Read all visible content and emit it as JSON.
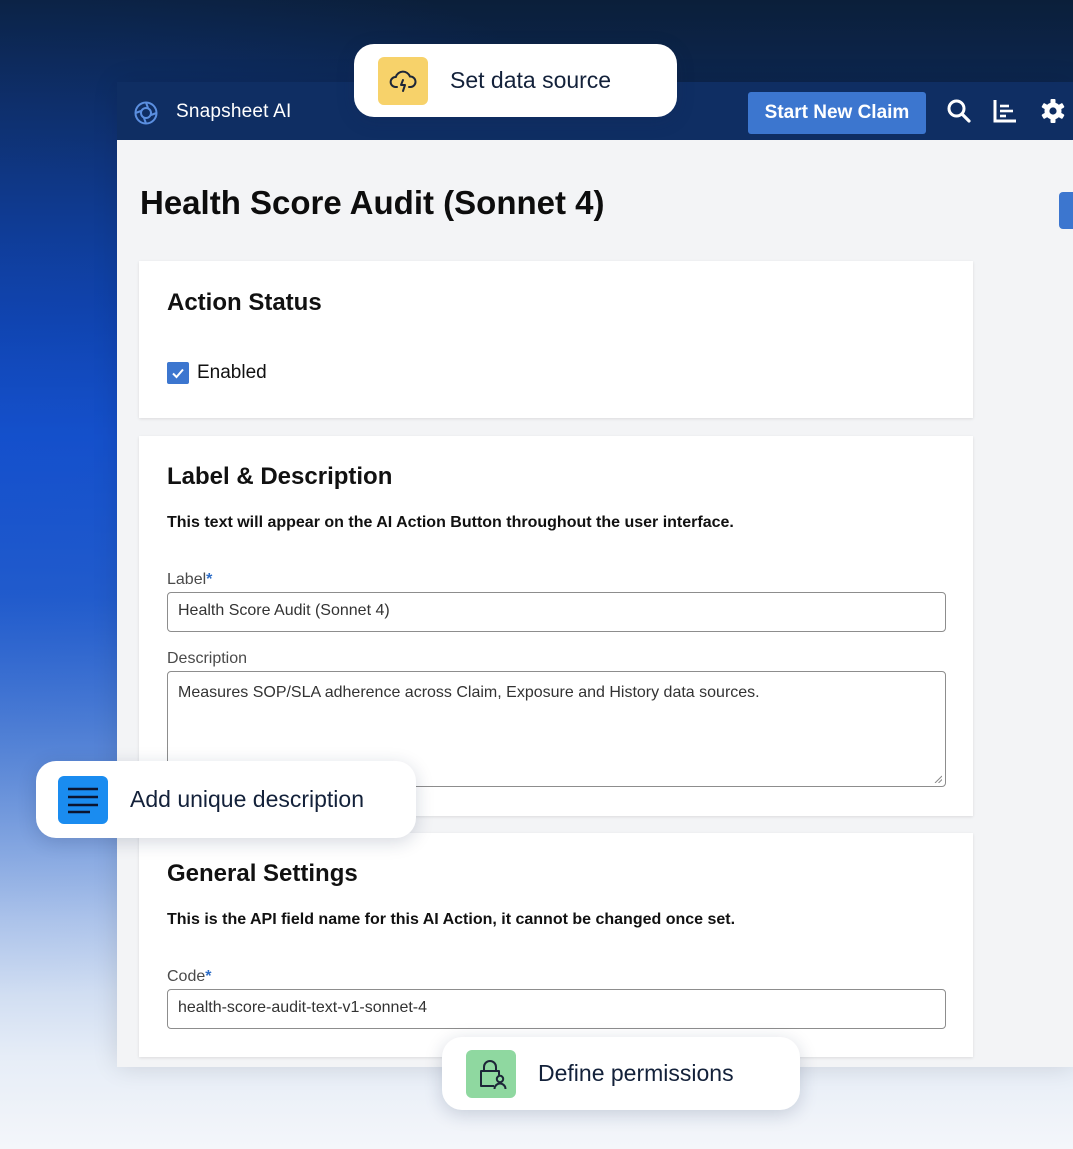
{
  "app": {
    "brand": "Snapsheet AI",
    "start_claim_label": "Start New Claim"
  },
  "page": {
    "title": "Health Score Audit (Sonnet 4)"
  },
  "action_status": {
    "title": "Action Status",
    "enabled_label": "Enabled",
    "enabled": true
  },
  "label_description": {
    "title": "Label & Description",
    "subtitle": "This text will appear on the AI Action Button throughout the user interface.",
    "label_field": "Label",
    "label_value": "Health Score Audit (Sonnet 4)",
    "description_field": "Description",
    "description_value": "Measures SOP/SLA adherence across Claim, Exposure and History data sources."
  },
  "general_settings": {
    "title": "General Settings",
    "subtitle": "This is the API field name for this AI Action, it cannot be changed once set.",
    "code_field": "Code",
    "code_value": "health-score-audit-text-v1-sonnet-4"
  },
  "required_marker": "*",
  "callouts": {
    "data_source": {
      "text": "Set data source",
      "icon": "cloud-icon",
      "color": "#f7d26a"
    },
    "description": {
      "text": "Add unique description",
      "icon": "text-lines-icon",
      "color": "#1a8cf0"
    },
    "permissions": {
      "text": "Define permissions",
      "icon": "lock-user-icon",
      "color": "#8fd8a0"
    }
  },
  "colors": {
    "topbar": "#0f2e63",
    "accent": "#3c76cf"
  }
}
